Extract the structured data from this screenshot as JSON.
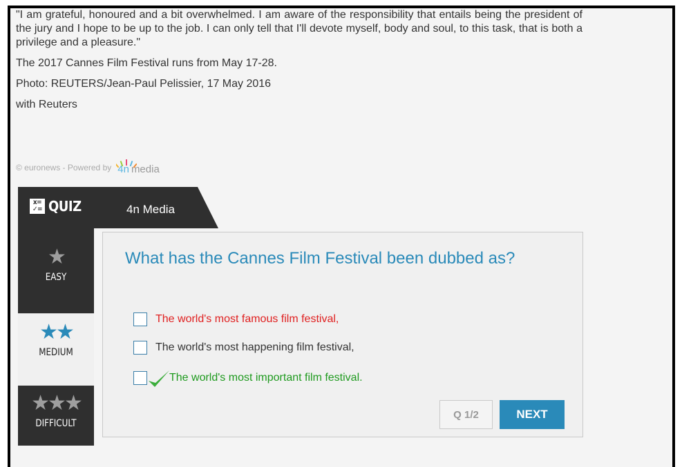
{
  "article": {
    "quote": "\"I am grateful, honoured and a bit overwhelmed. I am aware of the responsibility that entails being the president of the jury and I hope to be up to the job. I can only tell that I'll devote myself, body and soul, to this task, that is both a privilege and a pleasure.\"",
    "dates": "The 2017 Cannes Film Festival runs from May 17-28.",
    "photo": "Photo: REUTERS/Jean-Paul Pelissier, 17 May 2016",
    "source": "with Reuters"
  },
  "credit": {
    "text": "© euronews - Powered by",
    "logo_4n": "4n",
    "logo_media": "media"
  },
  "quiz": {
    "logo_text": "QUIZ",
    "brand": "4n Media",
    "levels": [
      {
        "label": "EASY",
        "stars": "★"
      },
      {
        "label": "MEDIUM",
        "stars": "★★"
      },
      {
        "label": "DIFFICULT",
        "stars": "★★★"
      }
    ],
    "selected_level": "MEDIUM",
    "question": "What has the Cannes Film Festival been dubbed as?",
    "options": [
      {
        "text": "The world's most famous film festival,",
        "state": "wrong"
      },
      {
        "text": "The world's most happening film festival,",
        "state": "neutral"
      },
      {
        "text": "The world's most important film festival.",
        "state": "correct"
      }
    ],
    "counter": "Q 1/2",
    "next_label": "NEXT"
  },
  "colors": {
    "accent": "#2a8ab9",
    "wrong": "#e02020",
    "correct": "#1e9a1e",
    "panel_dark": "#2f2f2f"
  }
}
